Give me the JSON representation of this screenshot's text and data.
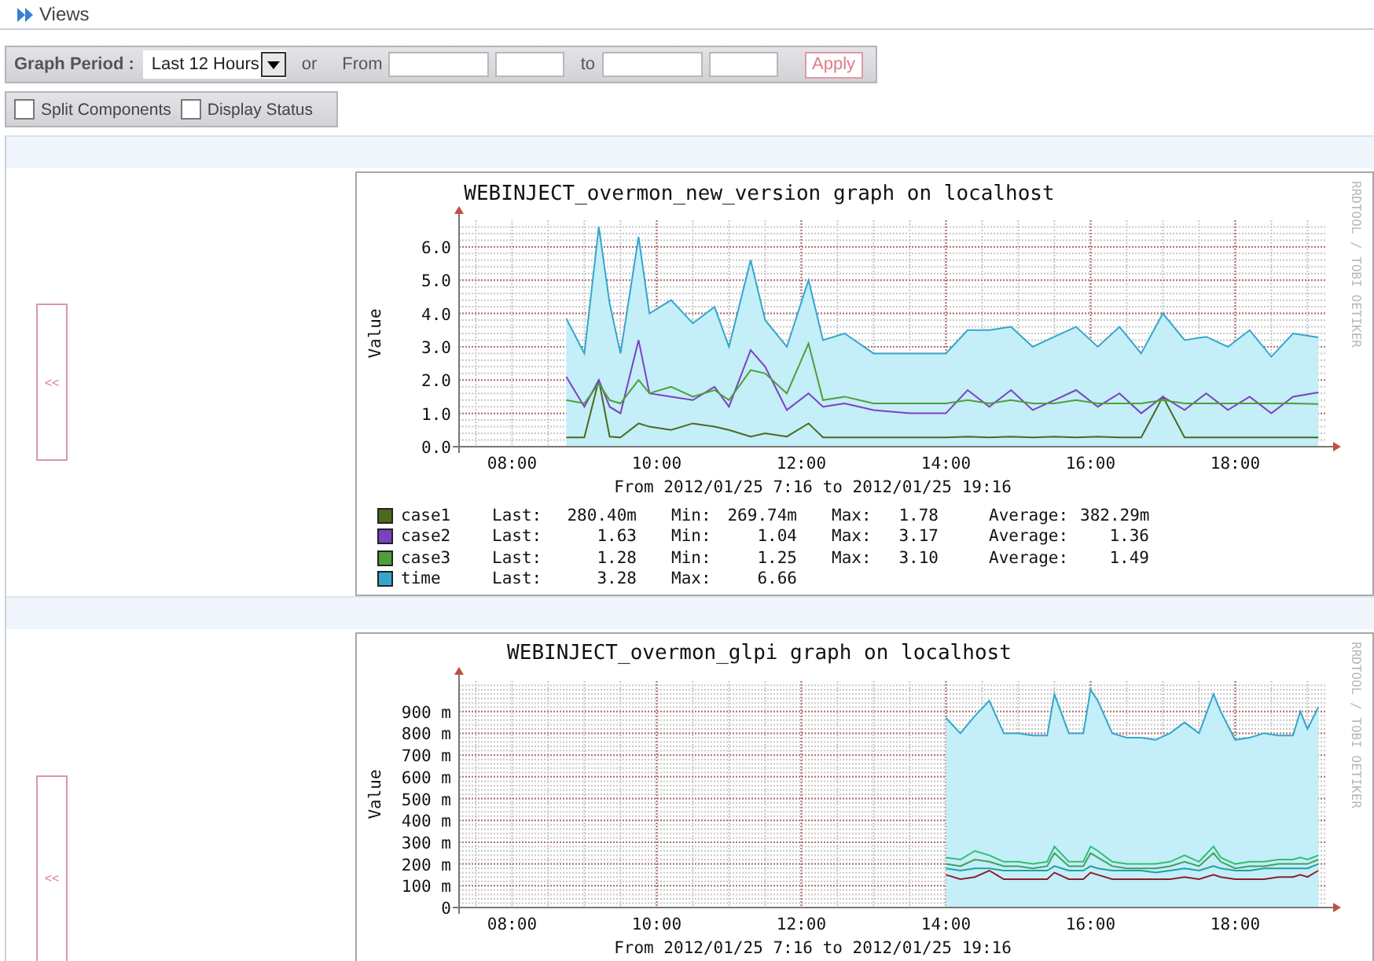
{
  "breadcrumb": {
    "label": "Views"
  },
  "toolbar": {
    "period_label": "Graph Period :",
    "period": {
      "value": "Last 12 Hours"
    },
    "or_label": "or",
    "from_label": "From",
    "to_label": "to",
    "apply_button": "Apply"
  },
  "options": [
    {
      "label": "Split Components",
      "checked": false
    },
    {
      "label": "Display Status",
      "checked": false
    }
  ],
  "graphs": [
    {
      "collapse_button": "<<",
      "watermark": "RRDTOOL / TOBI OETIKER",
      "chart_data": {
        "type": "line",
        "grid": true,
        "title": "WEBINJECT_overmon_new_version graph on localhost",
        "xlabel": "From 2012/01/25 7:16 to 2012/01/25 19:16",
        "ylabel": "Value",
        "xlim": [
          7.267,
          19.267
        ],
        "ylim": [
          0,
          6.8
        ],
        "xticks": [
          {
            "value": 8,
            "label": "08:00"
          },
          {
            "value": 10,
            "label": "10:00"
          },
          {
            "value": 12,
            "label": "12:00"
          },
          {
            "value": 14,
            "label": "14:00"
          },
          {
            "value": 16,
            "label": "16:00"
          },
          {
            "value": 18,
            "label": "18:00"
          }
        ],
        "yticks": [
          {
            "value": 0,
            "label": "0.0"
          },
          {
            "value": 1,
            "label": "1.0"
          },
          {
            "value": 2,
            "label": "2.0"
          },
          {
            "value": 3,
            "label": "3.0"
          },
          {
            "value": 4,
            "label": "4.0"
          },
          {
            "value": 5,
            "label": "5.0"
          },
          {
            "value": 6,
            "label": "6.0"
          }
        ],
        "x": [
          8.75,
          9.0,
          9.2,
          9.35,
          9.5,
          9.75,
          9.9,
          10.2,
          10.5,
          10.8,
          11.0,
          11.3,
          11.5,
          11.8,
          12.1,
          12.3,
          12.6,
          13.0,
          13.5,
          14.0,
          14.3,
          14.6,
          14.9,
          15.2,
          15.5,
          15.8,
          16.1,
          16.4,
          16.7,
          17.0,
          17.3,
          17.6,
          17.9,
          18.2,
          18.5,
          18.8,
          19.15
        ],
        "series": [
          {
            "name": "case1",
            "color": "#4a6a1c",
            "type": "line",
            "values": [
              0.28,
              0.28,
              2.0,
              0.3,
              0.28,
              0.7,
              0.6,
              0.5,
              0.7,
              0.6,
              0.5,
              0.3,
              0.4,
              0.3,
              0.7,
              0.28,
              0.28,
              0.28,
              0.28,
              0.28,
              0.3,
              0.28,
              0.3,
              0.28,
              0.3,
              0.28,
              0.3,
              0.28,
              0.28,
              1.5,
              0.28,
              0.28,
              0.28,
              0.28,
              0.28,
              0.28,
              0.28
            ]
          },
          {
            "name": "case2",
            "color": "#7a42bf",
            "type": "line",
            "values": [
              2.1,
              1.2,
              2.0,
              1.2,
              1.0,
              3.2,
              1.6,
              1.5,
              1.4,
              1.8,
              1.2,
              2.9,
              2.4,
              1.1,
              1.6,
              1.2,
              1.3,
              1.1,
              1.0,
              1.0,
              1.7,
              1.2,
              1.7,
              1.1,
              1.4,
              1.7,
              1.2,
              1.6,
              1.0,
              1.5,
              1.1,
              1.6,
              1.1,
              1.5,
              1.0,
              1.5,
              1.63
            ]
          },
          {
            "name": "case3",
            "color": "#4f9e3a",
            "type": "line",
            "values": [
              1.4,
              1.3,
              1.9,
              1.4,
              1.3,
              2.0,
              1.6,
              1.8,
              1.5,
              1.7,
              1.4,
              2.3,
              2.2,
              1.6,
              3.1,
              1.4,
              1.5,
              1.3,
              1.3,
              1.3,
              1.4,
              1.3,
              1.4,
              1.3,
              1.3,
              1.4,
              1.3,
              1.3,
              1.3,
              1.4,
              1.3,
              1.3,
              1.3,
              1.3,
              1.3,
              1.3,
              1.28
            ]
          },
          {
            "name": "time",
            "color": "#35a6cc",
            "type": "area",
            "values": [
              3.85,
              2.8,
              6.6,
              4.3,
              2.8,
              6.3,
              4.0,
              4.4,
              3.7,
              4.2,
              3.0,
              5.6,
              3.8,
              3.0,
              5.0,
              3.2,
              3.4,
              2.8,
              2.8,
              2.8,
              3.5,
              3.5,
              3.6,
              3.0,
              3.3,
              3.6,
              3.0,
              3.6,
              2.8,
              4.0,
              3.2,
              3.3,
              3.0,
              3.5,
              2.7,
              3.4,
              3.28
            ]
          }
        ]
      },
      "legend": [
        {
          "stats": [
            {
              "label": "Last:",
              "value": "280.40m"
            },
            {
              "label": "Min:",
              "value": "269.74m"
            },
            {
              "label": "Max:",
              "value": "1.78"
            },
            {
              "label": "Average:",
              "value": "382.29m"
            }
          ]
        },
        {
          "stats": [
            {
              "label": "Last:",
              "value": "1.63"
            },
            {
              "label": "Min:",
              "value": "1.04"
            },
            {
              "label": "Max:",
              "value": "3.17"
            },
            {
              "label": "Average:",
              "value": "1.36"
            }
          ]
        },
        {
          "stats": [
            {
              "label": "Last:",
              "value": "1.28"
            },
            {
              "label": "Min:",
              "value": "1.25"
            },
            {
              "label": "Max:",
              "value": "3.10"
            },
            {
              "label": "Average:",
              "value": "1.49"
            }
          ]
        },
        {
          "stats": [
            {
              "label": "Last:",
              "value": "3.28"
            },
            {
              "label": "Max:",
              "value": "6.66"
            }
          ]
        }
      ]
    },
    {
      "collapse_button": "<<",
      "watermark": "RRDTOOL / TOBI OETIKER",
      "chart_data": {
        "type": "line",
        "grid": true,
        "title": "WEBINJECT_overmon_glpi graph on localhost",
        "xlabel": "From 2012/01/25 7:16 to 2012/01/25 19:16",
        "ylabel": "Value",
        "xlim": [
          7.267,
          19.267
        ],
        "ylim": [
          0,
          1040
        ],
        "xticks": [
          {
            "value": 8,
            "label": "08:00"
          },
          {
            "value": 10,
            "label": "10:00"
          },
          {
            "value": 12,
            "label": "12:00"
          },
          {
            "value": 14,
            "label": "14:00"
          },
          {
            "value": 16,
            "label": "16:00"
          },
          {
            "value": 18,
            "label": "18:00"
          }
        ],
        "yticks": [
          {
            "value": 0,
            "label": "0"
          },
          {
            "value": 100,
            "label": "100 m"
          },
          {
            "value": 200,
            "label": "200 m"
          },
          {
            "value": 300,
            "label": "300 m"
          },
          {
            "value": 400,
            "label": "400 m"
          },
          {
            "value": 500,
            "label": "500 m"
          },
          {
            "value": 600,
            "label": "600 m"
          },
          {
            "value": 700,
            "label": "700 m"
          },
          {
            "value": 800,
            "label": "800 m"
          },
          {
            "value": 900,
            "label": "900 m"
          }
        ],
        "x": [
          14.0,
          14.2,
          14.4,
          14.6,
          14.8,
          15.0,
          15.2,
          15.4,
          15.5,
          15.7,
          15.9,
          16.0,
          16.1,
          16.3,
          16.5,
          16.7,
          16.9,
          17.1,
          17.3,
          17.5,
          17.7,
          17.8,
          18.0,
          18.2,
          18.4,
          18.6,
          18.8,
          18.9,
          19.0,
          19.15
        ],
        "series": [
          {
            "color": "#35a6cc",
            "type": "area",
            "values": [
              870,
              800,
              880,
              950,
              800,
              800,
              790,
              790,
              980,
              800,
              800,
              1000,
              950,
              800,
              780,
              780,
              770,
              800,
              850,
              800,
              980,
              900,
              770,
              780,
              800,
              790,
              790,
              900,
              820,
              920
            ]
          },
          {
            "color": "#30c070",
            "type": "line",
            "values": [
              230,
              220,
              260,
              240,
              210,
              210,
              200,
              210,
              280,
              210,
              210,
              280,
              260,
              210,
              200,
              200,
              200,
              210,
              240,
              210,
              280,
              230,
              200,
              210,
              210,
              220,
              220,
              230,
              220,
              240
            ]
          },
          {
            "color": "#40a060",
            "type": "line",
            "values": [
              200,
              190,
              220,
              210,
              190,
              190,
              180,
              190,
              250,
              190,
              190,
              250,
              230,
              190,
              180,
              180,
              180,
              190,
              210,
              190,
              250,
              210,
              180,
              190,
              190,
              200,
              200,
              200,
              200,
              220
            ]
          },
          {
            "color": "#20a0a0",
            "type": "line",
            "values": [
              180,
              170,
              180,
              180,
              170,
              170,
              170,
              170,
              190,
              170,
              170,
              190,
              180,
              170,
              170,
              170,
              160,
              170,
              180,
              170,
              190,
              180,
              170,
              170,
              180,
              180,
              180,
              180,
              180,
              200
            ]
          },
          {
            "color": "#8a2030",
            "type": "line",
            "values": [
              150,
              130,
              140,
              170,
              130,
              130,
              130,
              130,
              160,
              130,
              130,
              160,
              150,
              130,
              130,
              130,
              130,
              130,
              140,
              130,
              150,
              140,
              130,
              130,
              130,
              140,
              140,
              150,
              140,
              170
            ]
          }
        ]
      }
    }
  ]
}
